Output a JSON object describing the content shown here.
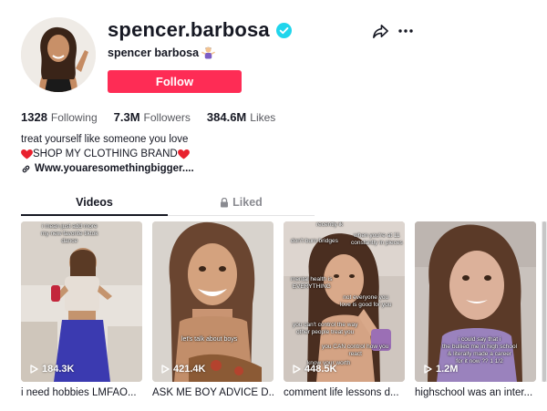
{
  "profile": {
    "username": "spencer.barbosa",
    "display_name": "spencer barbosa",
    "follow_label": "Follow",
    "verified_icon": "verified-check-icon",
    "accent_color": "#fe2c55",
    "verified_color": "#20d5ec"
  },
  "stats": [
    {
      "value": "1328",
      "label": "Following"
    },
    {
      "value": "7.3M",
      "label": "Followers"
    },
    {
      "value": "384.6M",
      "label": "Likes"
    }
  ],
  "bio": {
    "line1": "treat yourself like someone you love",
    "line2": "SHOP MY CLOTHING BRAND",
    "link": "Www.youaresomethingbigger...."
  },
  "tabs": {
    "videos": "Videos",
    "liked": "Liked"
  },
  "videos": [
    {
      "views": "184.3K",
      "caption": "i need hobbies LMFAO...",
      "overlay": [
        "i mean just add more",
        "my new favorite tiktok",
        "dance"
      ]
    },
    {
      "views": "421.4K",
      "caption": "ASK ME BOY ADVICE D...",
      "overlay": [
        "let's talk about boys"
      ]
    },
    {
      "views": "448.5K",
      "caption": "comment life lessons d...",
      "overlay": [
        "recently ik",
        "don't burn bridges",
        "when you're at 11",
        "constantly in pieces",
        "mental health is",
        "EVERYTHING",
        "not everyone you",
        "love is good for you",
        "you can't control the way",
        "other people treat you",
        "you CAN control how you",
        "react",
        "know your worth"
      ]
    },
    {
      "views": "1.2M",
      "caption": "highschool was an inter...",
      "overlay": [
        "i could say that i",
        "the bullied me in high school",
        "& literally made a career",
        "for it now ?? 1 1/2"
      ]
    }
  ]
}
